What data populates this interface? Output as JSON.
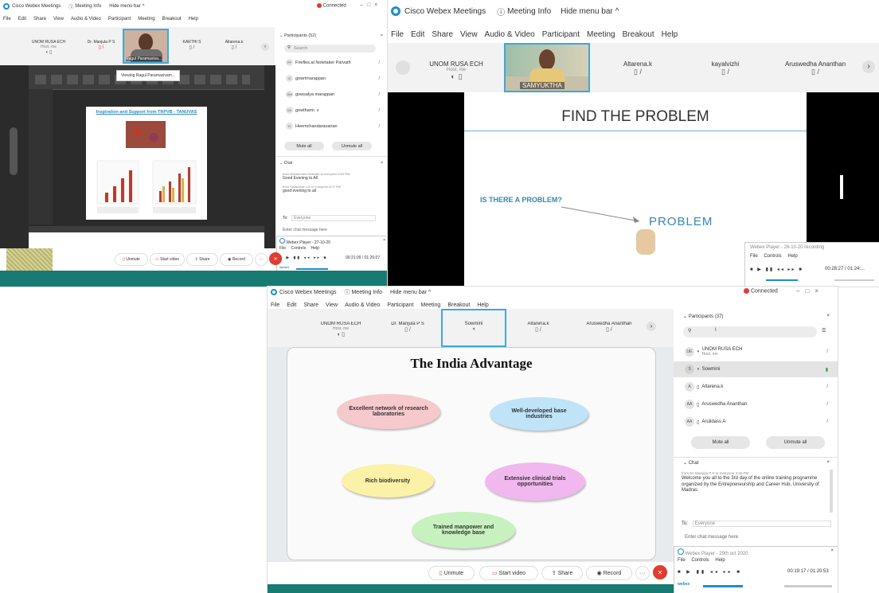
{
  "colors": {
    "webex_blue": "#1b8fd0",
    "teal_bar": "#177b74",
    "red": "#e23b2f",
    "tile_highlight": "#39a9e0",
    "slide_title_blue": "#2e8bc0",
    "pink": "#f6c9cc",
    "blue_ellipse": "#bfe3f7",
    "yellow": "#fbf2a8",
    "magenta": "#f0b8ef",
    "green": "#c7f2c0"
  },
  "top_left": {
    "title": {
      "app": "Cisco Webex Meetings",
      "meeting_info": "Meeting Info",
      "hide_menu": "Hide menu bar",
      "connected": "Connected"
    },
    "menu": [
      "File",
      "Edit",
      "Share",
      "View",
      "Audio & Video",
      "Participant",
      "Meeting",
      "Breakout",
      "Help"
    ],
    "tiles": [
      {
        "name": "UNOM RUSA ECH",
        "sub": "Host, me"
      },
      {
        "name": "Dr. Manjula P S",
        "sub": ""
      },
      {
        "name": "Ragul Paramasiva...",
        "sub": ""
      },
      {
        "name": "KARTHI S",
        "sub": ""
      },
      {
        "name": "Altarena.k",
        "sub": ""
      }
    ],
    "viewing_tooltip": "Viewing Ragul Paramasivam...",
    "slide": {
      "title": "Inspiration and Support from TRPVB - TANUVAS"
    },
    "participants_header": "Participants (52)",
    "search_placeholder": "Search",
    "participants": [
      {
        "initials": "FP",
        "name": "Firefles.al Notetaker Parvath"
      },
      {
        "initials": "G",
        "name": "gowrimarappan"
      },
      {
        "initials": "GM",
        "name": "gowsalya marappan"
      },
      {
        "initials": "GV",
        "name": "gowthami. v"
      },
      {
        "initials": "H",
        "name": "Heemchandaravarian"
      }
    ],
    "mute_all": "Mute all",
    "unmute_all": "Unmute all",
    "chat_header": "Chat",
    "chat_lines": [
      {
        "from": "from Mohammed Muthalib to everyone   5:59 PM",
        "text": "Good Evening to All"
      },
      {
        "from": "from Saravanan LG to everyone   6:07 PM",
        "text": "good evening to all"
      }
    ],
    "to_label": "To:",
    "to_value": "Everyone",
    "enter_chat": "Enter chat message here",
    "player": {
      "title": "Webex Player - 27-10-20",
      "menu": [
        "File",
        "Controls",
        "Help"
      ],
      "time": "00:21:09 / 01:26:07"
    },
    "buttons": {
      "unmute": "Unmute",
      "start_video": "Start video",
      "share": "Share",
      "record": "Record"
    }
  },
  "top_right": {
    "title": {
      "app": "Cisco Webex Meetings",
      "meeting_info": "Meeting Info",
      "hide_menu": "Hide menu bar"
    },
    "menu": [
      "File",
      "Edit",
      "Share",
      "View",
      "Audio & Video",
      "Participant",
      "Meeting",
      "Breakout",
      "Help"
    ],
    "tiles": [
      {
        "name": "UNOM RUSA ECH",
        "sub": "Host, me"
      },
      {
        "name": "SAMYUKTHA",
        "sub": ""
      },
      {
        "name": "Altarena.k",
        "sub": ""
      },
      {
        "name": "kayalvizhi",
        "sub": ""
      },
      {
        "name": "Aruswedha Ananthan",
        "sub": ""
      }
    ],
    "slide": {
      "title": "FIND THE PROBLEM",
      "question": "IS THERE A PROBLEM?",
      "word": "PROBLEM"
    },
    "player": {
      "title": "Webex Player - 28-10-20 recording",
      "menu": [
        "File",
        "Controls",
        "Help"
      ],
      "time": "00:28:27 / 01:24:..."
    }
  },
  "bottom": {
    "title": {
      "app": "Cisco Webex Meetings",
      "meeting_info": "Meeting Info",
      "hide_menu": "Hide menu bar",
      "connected": "Connected"
    },
    "menu": [
      "File",
      "Edit",
      "Share",
      "View",
      "Audio & Video",
      "Participant",
      "Meeting",
      "Breakout",
      "Help"
    ],
    "tiles": [
      {
        "name": "UNOM RUSA ECH",
        "sub": "Host, me"
      },
      {
        "name": "Dr. Manjula P S",
        "sub": ""
      },
      {
        "name": "Sowmini",
        "sub": ""
      },
      {
        "name": "Altarena.k",
        "sub": ""
      },
      {
        "name": "Aruswedha Ananthan",
        "sub": ""
      }
    ],
    "slide": {
      "title": "The India Advantage",
      "items": [
        "Excellent network of research laboratories",
        "Well-developed base industries",
        "Rich biodiversity",
        "Extensive clinical trials opportunities",
        "Trained manpower and knowledge base"
      ]
    },
    "participants_header": "Participants (37)",
    "participants": [
      {
        "initials": "UE",
        "name": "UNOM RUSA ECH",
        "sub": "Host, me"
      },
      {
        "initials": "S",
        "name": "Sowmini",
        "sub": ""
      },
      {
        "initials": "A",
        "name": "Altarena.k",
        "sub": ""
      },
      {
        "initials": "AA",
        "name": "Aruswedha Ananthan",
        "sub": ""
      },
      {
        "initials": "AA",
        "name": "Arulidass A",
        "sub": ""
      }
    ],
    "mute_all": "Mute all",
    "unmute_all": "Unmute all",
    "chat_header": "Chat",
    "chat_from": "from Dr. Manjula P S to everyone   3:22 PM",
    "chat_text": "Welcome you all to the 3rd day of the online training programme organized by the Entrepreneurship and Career Hub, University of Madras",
    "to_label": "To:",
    "to_value": "Everyone",
    "enter_chat": "Enter chat message here",
    "player": {
      "title": "Webex Player - 29th oct 2020",
      "menu": [
        "File",
        "Controls",
        "Help"
      ],
      "time": "00:19:17 / 01:20:53"
    },
    "buttons": {
      "unmute": "Unmute",
      "start_video": "Start video",
      "share": "Share",
      "record": "Record"
    }
  }
}
